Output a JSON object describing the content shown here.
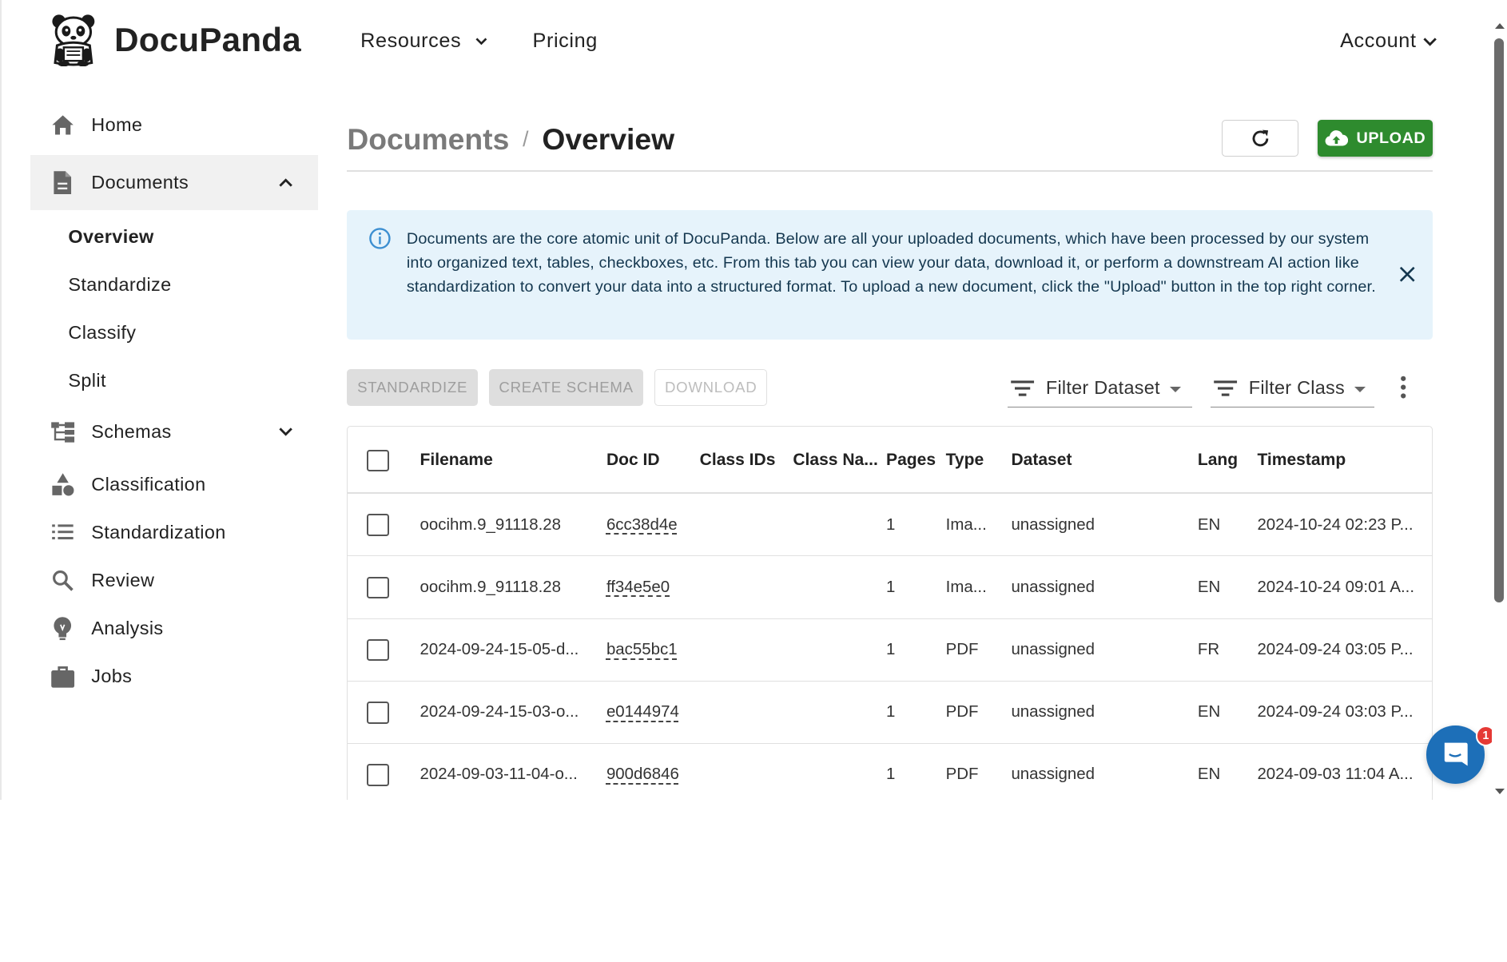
{
  "app": {
    "brand": "DocuPanda"
  },
  "topnav": {
    "resources": "Resources",
    "pricing": "Pricing",
    "account": "Account"
  },
  "sidebar": {
    "home": "Home",
    "documents": "Documents",
    "sub": [
      "Overview",
      "Standardize",
      "Classify",
      "Split"
    ],
    "schemas": "Schemas",
    "classification": "Classification",
    "standardization": "Standardization",
    "review": "Review",
    "analysis": "Analysis",
    "jobs": "Jobs"
  },
  "breadcrumb": {
    "parent": "Documents",
    "separator": "/",
    "current": "Overview"
  },
  "header": {
    "upload": "UPLOAD"
  },
  "alert": {
    "text": "Documents are the core atomic unit of DocuPanda. Below are all your uploaded documents, which have been processed by our system into organized text, tables, checkboxes, etc. From this tab you can view your data, download it, or perform a downstream AI action like standardization to convert your data into a structured format. To upload a new document, click the \"Upload\" button in the top right corner."
  },
  "toolbar": {
    "standardize": "STANDARDIZE",
    "create_schema": "CREATE SCHEMA",
    "download": "DOWNLOAD",
    "filter_dataset": "Filter Dataset",
    "filter_class": "Filter Class"
  },
  "table": {
    "columns": [
      "Filename",
      "Doc ID",
      "Class IDs",
      "Class Na...",
      "Pages",
      "Type",
      "Dataset",
      "Lang",
      "Timestamp"
    ],
    "rows": [
      {
        "filename": "oocihm.9_91118.28",
        "doc_id": "6cc38d4e",
        "class_ids": "",
        "class_name": "",
        "pages": "1",
        "type": "Ima...",
        "dataset": "unassigned",
        "lang": "EN",
        "timestamp": "2024-10-24 02:23 P..."
      },
      {
        "filename": "oocihm.9_91118.28",
        "doc_id": "ff34e5e0",
        "class_ids": "",
        "class_name": "",
        "pages": "1",
        "type": "Ima...",
        "dataset": "unassigned",
        "lang": "EN",
        "timestamp": "2024-10-24 09:01 A..."
      },
      {
        "filename": "2024-09-24-15-05-d...",
        "doc_id": "bac55bc1",
        "class_ids": "",
        "class_name": "",
        "pages": "1",
        "type": "PDF",
        "dataset": "unassigned",
        "lang": "FR",
        "timestamp": "2024-09-24 03:05 P..."
      },
      {
        "filename": "2024-09-24-15-03-o...",
        "doc_id": "e0144974",
        "class_ids": "",
        "class_name": "",
        "pages": "1",
        "type": "PDF",
        "dataset": "unassigned",
        "lang": "EN",
        "timestamp": "2024-09-24 03:03 P..."
      },
      {
        "filename": "2024-09-03-11-04-o...",
        "doc_id": "900d6846",
        "class_ids": "",
        "class_name": "",
        "pages": "1",
        "type": "PDF",
        "dataset": "unassigned",
        "lang": "EN",
        "timestamp": "2024-09-03 11:04 A..."
      }
    ]
  },
  "chat": {
    "badge": "1"
  },
  "colors": {
    "accent_green": "#2e8b2e",
    "alert_bg": "#e6f3fb",
    "chat_blue": "#1d6fb8",
    "badge_red": "#e53935"
  }
}
